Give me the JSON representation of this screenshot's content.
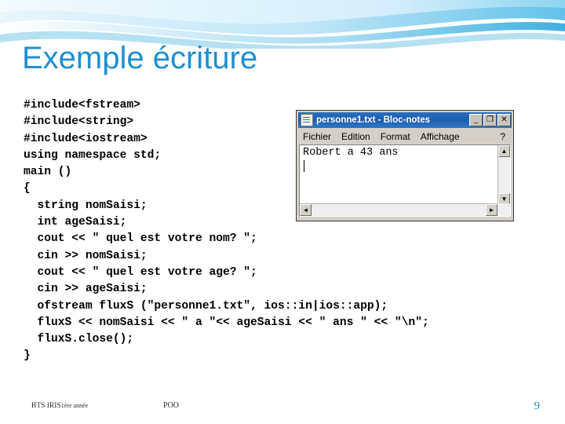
{
  "slide": {
    "title": "Exemple écriture",
    "code": "#include<fstream>\n#include<string>\n#include<iostream>\nusing namespace std;\nmain ()\n{\n  string nomSaisi;\n  int ageSaisi;\n  cout << \" quel est votre nom? \";\n  cin >> nomSaisi;\n  cout << \" quel est votre age? \";\n  cin >> ageSaisi;\n  ofstream fluxS (\"personne1.txt\", ios::in|ios::app);\n  fluxS << nomSaisi << \" a \"<< ageSaisi << \" ans \" << \"\\n\";\n  fluxS.close();\n}",
    "accent_color": "#1f8fd0"
  },
  "notepad": {
    "title": "personne1.txt - Bloc-notes",
    "buttons": {
      "minimize": "_",
      "maximize": "❐",
      "close": "✕"
    },
    "menu": [
      "Fichier",
      "Edition",
      "Format",
      "Affichage"
    ],
    "help_menu": "?",
    "content": "Robert a 43 ans",
    "scroll": {
      "up": "▲",
      "down": "▼",
      "left": "◄",
      "right": "►"
    }
  },
  "footer": {
    "left_main": "BTS IRIS",
    "left_sub": "1ère année",
    "center": "POO",
    "page_number": "9"
  }
}
